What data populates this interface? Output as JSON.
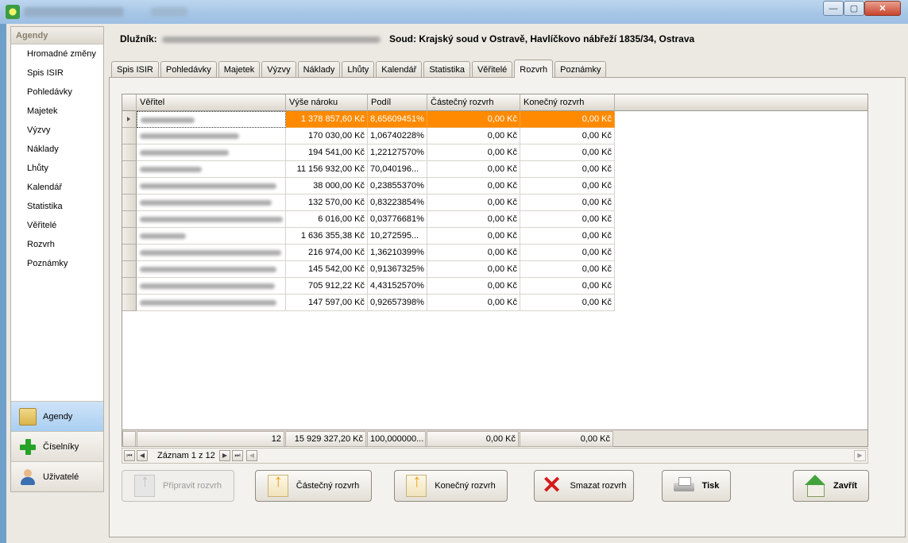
{
  "header": {
    "debtor_label": "Dlužník:",
    "court_text": "Soud: Krajský soud v Ostravě, Havlíčkovo nábřeží 1835/34, Ostrava"
  },
  "sidebar": {
    "title": "Agendy",
    "items": [
      "Hromadné změny",
      "Spis ISIR",
      "Pohledávky",
      "Majetek",
      "Výzvy",
      "Náklady",
      "Lhůty",
      "Kalendář",
      "Statistika",
      "Věřitelé",
      "Rozvrh",
      "Poznámky"
    ],
    "sections": [
      "Agendy",
      "Číselníky",
      "Uživatelé"
    ]
  },
  "tabs": [
    "Spis ISIR",
    "Pohledávky",
    "Majetek",
    "Výzvy",
    "Náklady",
    "Lhůty",
    "Kalendář",
    "Statistika",
    "Věřitelé",
    "Rozvrh",
    "Poznámky"
  ],
  "active_tab": "Rozvrh",
  "grid": {
    "columns": [
      "Věřitel",
      "Výše nároku",
      "Podíl",
      "Částečný rozvrh",
      "Konečný rozvrh"
    ],
    "rows": [
      [
        "1 378 857,60 Kč",
        "8,65609451%",
        "0,00 Kč",
        "0,00 Kč"
      ],
      [
        "170 030,00 Kč",
        "1,06740228%",
        "0,00 Kč",
        "0,00 Kč"
      ],
      [
        "194 541,00 Kč",
        "1,22127570%",
        "0,00 Kč",
        "0,00 Kč"
      ],
      [
        "11 156 932,00 Kč",
        "70,040196...",
        "0,00 Kč",
        "0,00 Kč"
      ],
      [
        "38 000,00 Kč",
        "0,23855370%",
        "0,00 Kč",
        "0,00 Kč"
      ],
      [
        "132 570,00 Kč",
        "0,83223854%",
        "0,00 Kč",
        "0,00 Kč"
      ],
      [
        "6 016,00 Kč",
        "0,03776681%",
        "0,00 Kč",
        "0,00 Kč"
      ],
      [
        "1 636 355,38 Kč",
        "10,272595...",
        "0,00 Kč",
        "0,00 Kč"
      ],
      [
        "216 974,00 Kč",
        "1,36210399%",
        "0,00 Kč",
        "0,00 Kč"
      ],
      [
        "145 542,00 Kč",
        "0,91367325%",
        "0,00 Kč",
        "0,00 Kč"
      ],
      [
        "705 912,22 Kč",
        "4,43152570%",
        "0,00 Kč",
        "0,00 Kč"
      ],
      [
        "147 597,00 Kč",
        "0,92657398%",
        "0,00 Kč",
        "0,00 Kč"
      ]
    ],
    "footer": [
      "12",
      "15 929 327,20 Kč",
      "100,000000...",
      "0,00 Kč",
      "0,00 Kč"
    ],
    "navigator": "Záznam 1 z 12"
  },
  "buttons": {
    "prepare": "Připravit rozvrh",
    "partial": "Částečný rozvrh",
    "final": "Konečný rozvrh",
    "delete": "Smazat rozvrh",
    "print": "Tisk",
    "close": "Zavřít"
  },
  "colors": {
    "selected_row": "#ff8a00",
    "active_section": "#a9cff2"
  }
}
